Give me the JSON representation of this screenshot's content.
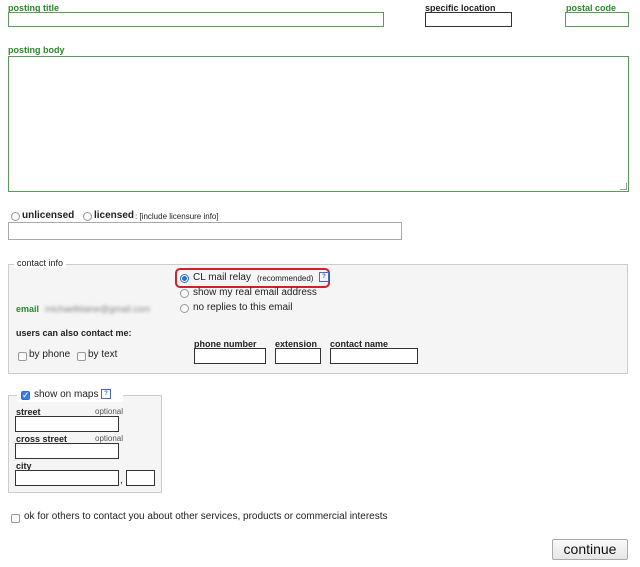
{
  "posting": {
    "title_label": "posting title",
    "location_label": "specific location",
    "postal_label": "postal code",
    "body_label": "posting body"
  },
  "license": {
    "unlicensed": "unlicensed",
    "licensed": "licensed",
    "info": ": [include licensure info]"
  },
  "contact": {
    "legend": "contact info",
    "email_label": "email",
    "email_value": "michaelblaine@gmail.com",
    "relay_label": "CL mail relay",
    "relay_note": "(recommended)",
    "real_email": "show my real email address",
    "no_replies": "no replies to this email",
    "also_contact": "users can also contact me:",
    "by_phone": "by phone",
    "by_text": "by text",
    "phone_label": "phone number",
    "extension_label": "extension",
    "contact_name_label": "contact name",
    "help_glyph": "?"
  },
  "maps": {
    "show_label": "show on maps",
    "street_label": "street",
    "cross_label": "cross street",
    "optional": "optional",
    "city_label": "city",
    "comma": ","
  },
  "consent": "ok for others to contact you about other services, products or commercial interests",
  "continue_label": "continue",
  "colors": {
    "green": "#2a8a2a",
    "highlight": "#d0202a",
    "accent": "#2a6fd6"
  }
}
